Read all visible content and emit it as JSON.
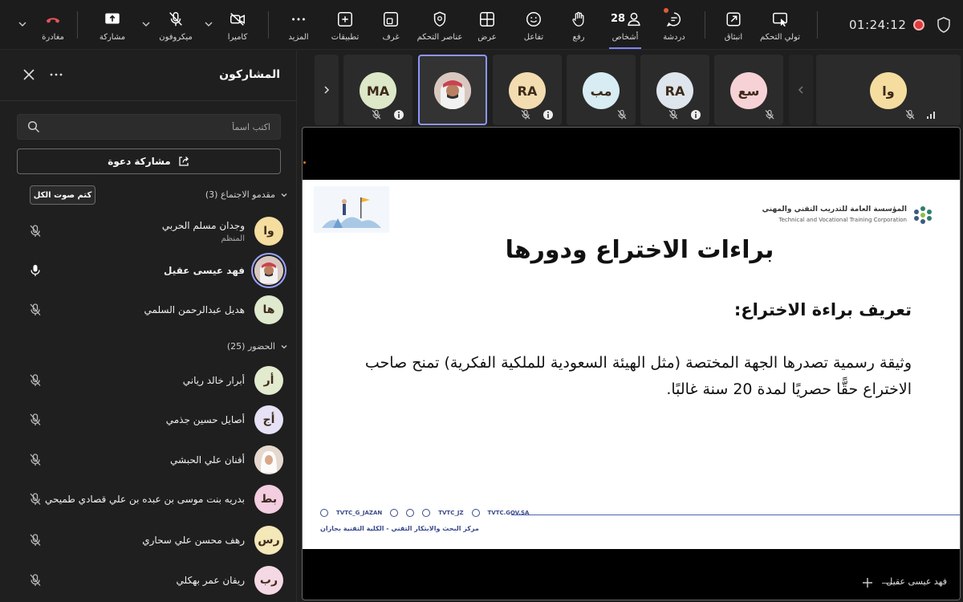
{
  "toolbar": {
    "leave_label": "مغادرة",
    "share_label": "مشاركة",
    "mic_label": "ميكروفون",
    "camera_label": "كاميرا",
    "more_label": "المزيد",
    "apps_label": "تطبيقات",
    "rooms_label": "غرف",
    "controls_label": "عناصر التحكم",
    "view_label": "عرض",
    "react_label": "تفاعل",
    "raise_label": "رفع",
    "people_label": "أشخاص",
    "people_count": "28",
    "chat_label": "دردشة",
    "popout_label": "انبثاق",
    "take_control_label": "تولي التحكم",
    "timer": "01:24:12"
  },
  "panel": {
    "title": "المشاركون",
    "search_placeholder": "اكتب اسماً",
    "invite_label": "مشاركة دعوة",
    "mute_all_label": "كتم صوت الكل",
    "presenters_header": "مقدمو الاجتماع (3)",
    "attendees_header": "الحضور (25)",
    "presenters": [
      {
        "initials": "وا",
        "name": "وجدان مسلم الحربي",
        "role": "المنظم",
        "color": "#f4dd9f",
        "mic": "muted"
      },
      {
        "initials": "",
        "name": "فهد عيسى عقيل",
        "role": "",
        "color": "#e9d9d1",
        "mic": "on"
      },
      {
        "initials": "ها",
        "name": "هديل عبدالرحمن السلمي",
        "role": "",
        "color": "#dfe9cd",
        "mic": "muted"
      }
    ],
    "attendees": [
      {
        "initials": "أر",
        "name": "أبرار خالد رياني",
        "color": "#e3ebcf",
        "mic": "muted"
      },
      {
        "initials": "أج",
        "name": "أصايل حسين جذمي",
        "color": "#e6e1f4",
        "mic": "muted"
      },
      {
        "initials": "",
        "name": "أفنان علي الحبشي",
        "color": "#e8d7cc",
        "mic": "muted"
      },
      {
        "initials": "بط",
        "name": "بدريه بنت موسى بن عبده بن علي قصادي طميحي",
        "color": "#f3cde0",
        "mic": "muted"
      },
      {
        "initials": "رس",
        "name": "رهف محسن علي سحاري",
        "color": "#f4e7b8",
        "mic": "muted"
      },
      {
        "initials": "رب",
        "name": "ريفان عمر بهكلي",
        "color": "#f4d9e4",
        "mic": "muted"
      }
    ]
  },
  "strip": {
    "tiles": [
      {
        "initials": "MA",
        "color": "#dce8c8"
      },
      {
        "initials": "",
        "color": "#e9d9d1"
      },
      {
        "initials": "RA",
        "color": "#f3dcb0"
      },
      {
        "initials": "مب",
        "color": "#d8ecf3"
      },
      {
        "initials": "RA",
        "color": "#dfe5ec"
      },
      {
        "initials": "سع",
        "color": "#f6d2d6"
      },
      {
        "initials": "وا",
        "color": "#f4dd9f"
      }
    ]
  },
  "slide": {
    "org_ar": "المؤسسة العامة للتدريب التقني والمهني",
    "org_en": "Technical and Vocational Training Corporation",
    "title": "براءات الاختراع ودورها",
    "subtitle": "تعريف براءة الاختراع:",
    "body": "وثيقة رسمية تصدرها الجهة المختصة (مثل الهيئة السعودية للملكية الفكرية) تمنح صاحب الاختراع حقًّا حصريًا لمدة 20 سنة غالبًا.",
    "social_1": "TVTC_G_JAZAN",
    "social_2": "TVTC_JZ",
    "social_3": "TVTC.GOV.SA",
    "center_name": "مركز البحث والابتكار التقني - الكلية التقنية بجازان"
  },
  "stage": {
    "presenter_name": "فهد عيسى عقيل"
  },
  "colors": {
    "accent": "#7f85f5",
    "leave": "#e8535b",
    "record": "#e03b3b"
  }
}
